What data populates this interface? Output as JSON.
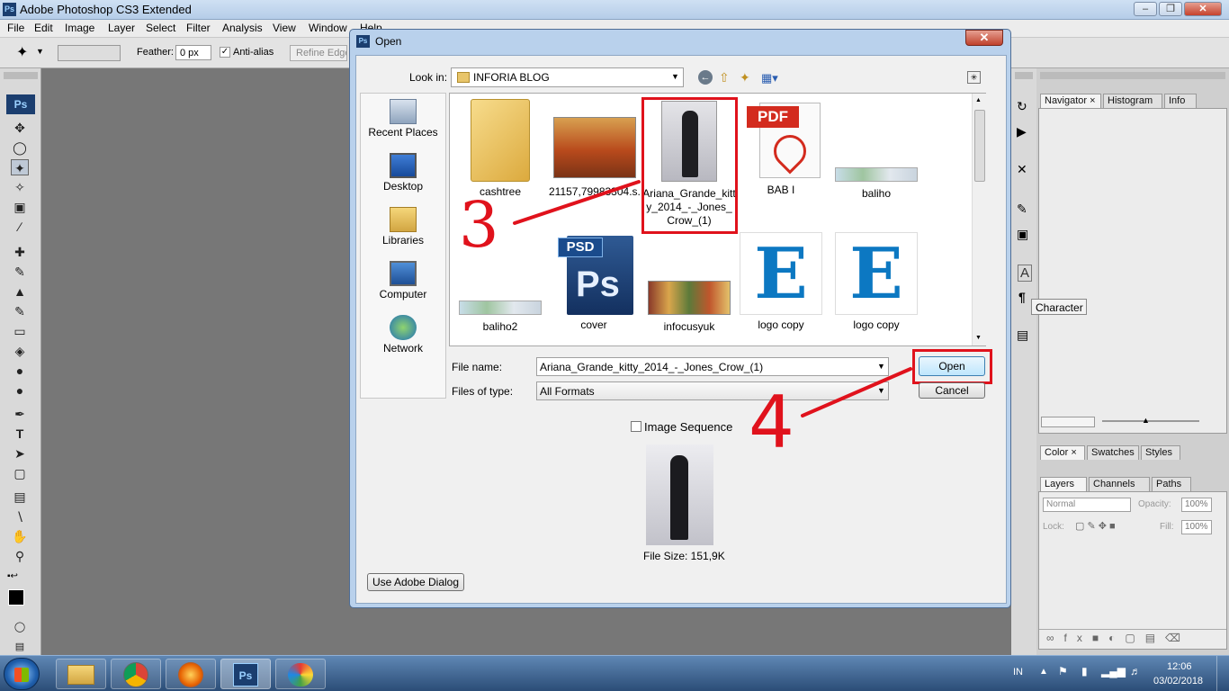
{
  "app": {
    "title": "Adobe Photoshop CS3 Extended",
    "logo": "Ps"
  },
  "menu": [
    "File",
    "Edit",
    "Image",
    "Layer",
    "Select",
    "Filter",
    "Analysis",
    "View",
    "Window",
    "Help"
  ],
  "options": {
    "feather_label": "Feather:",
    "feather_value": "0 px",
    "antialias_label": "Anti-alias",
    "antialias_checked": true,
    "refine_edge_label": "Refine Edge..."
  },
  "tools_logo": "Ps",
  "dialog": {
    "title": "Open",
    "look_in_label": "Look in:",
    "look_in_value": "INFORIA BLOG",
    "places": [
      "Recent Places",
      "Desktop",
      "Libraries",
      "Computer",
      "Network"
    ],
    "files": [
      {
        "name": "cashtree",
        "icon": "folder-icon"
      },
      {
        "name": "21157,79983304.s...",
        "icon": "image-thumbnail"
      },
      {
        "name": "Ariana_Grande_kitty_2014_-_Jones_Crow_(1)",
        "icon": "image-thumbnail",
        "selected": true
      },
      {
        "name": "BAB I",
        "icon": "pdf-icon"
      },
      {
        "name": "baliho",
        "icon": "image-thumbnail"
      },
      {
        "name": "baliho2",
        "icon": "image-thumbnail"
      },
      {
        "name": "cover",
        "icon": "psd-icon"
      },
      {
        "name": "infocusyuk",
        "icon": "image-thumbnail"
      },
      {
        "name": "logo copy",
        "icon": "logo-thumbnail"
      },
      {
        "name": "logo copy",
        "icon": "logo-thumbnail"
      }
    ],
    "pdf_badge": "PDF",
    "psd_badge": "PSD",
    "psd_letters": "Ps",
    "logo_letter": "E",
    "file_name_label": "File name:",
    "file_name_value": "Ariana_Grande_kitty_2014_-_Jones_Crow_(1)",
    "files_of_type_label": "Files of type:",
    "files_of_type_value": "All Formats",
    "open_button": "Open",
    "cancel_button": "Cancel",
    "image_sequence_label": "Image Sequence",
    "image_sequence_checked": false,
    "file_size": "File Size: 151,9K",
    "use_adobe_dialog": "Use Adobe Dialog"
  },
  "annotations": {
    "step3": "3",
    "step4": "4",
    "color": "#e0121c"
  },
  "panels": {
    "nav_tabs": [
      "Navigator",
      "Histogram",
      "Info"
    ],
    "character_tooltip": "Character",
    "color_tabs": [
      "Color",
      "Swatches",
      "Styles"
    ],
    "layers_tabs": [
      "Layers",
      "Channels",
      "Paths"
    ],
    "blend_mode": "Normal",
    "opacity_label": "Opacity:",
    "opacity_value": "100%",
    "lock_label": "Lock:",
    "fill_label": "Fill:",
    "fill_value": "100%"
  },
  "taskbar": {
    "lang": "IN",
    "time": "12:06",
    "date": "03/02/2018",
    "ps_label": "Ps"
  }
}
